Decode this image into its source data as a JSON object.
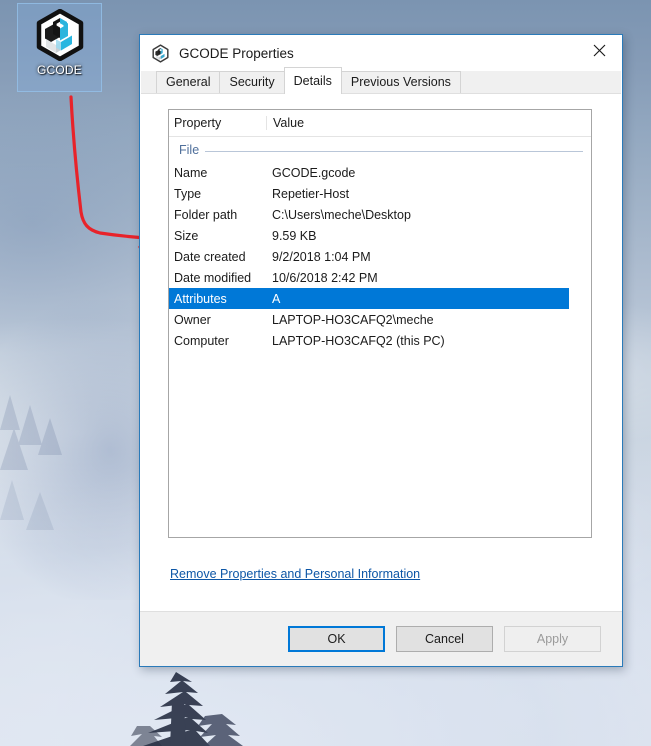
{
  "desktop": {
    "icon": {
      "name": "GCODE",
      "icon_glyph": "repetier-host-hexagon-icon",
      "selected": true
    },
    "annotation": {
      "type": "hand-drawn-arrow",
      "color": "#e8232a",
      "points_to": "Folder path"
    },
    "wallpaper": {
      "description": "misty forest mountain",
      "sky_color": "#7b94b1",
      "mist_color": "#eef1f6"
    }
  },
  "dialog": {
    "title": "GCODE Properties",
    "title_icon": "repetier-host-hexagon-icon",
    "close_label": "✕",
    "close_icon": "close-icon",
    "tabs": [
      {
        "label": "General",
        "active": false
      },
      {
        "label": "Security",
        "active": false
      },
      {
        "label": "Details",
        "active": true
      },
      {
        "label": "Previous Versions",
        "active": false
      }
    ],
    "table": {
      "headers": {
        "property": "Property",
        "value": "Value"
      },
      "groups": [
        {
          "name": "File",
          "rows": [
            {
              "property": "Name",
              "value": "GCODE.gcode",
              "selected": false
            },
            {
              "property": "Type",
              "value": "Repetier-Host",
              "selected": false
            },
            {
              "property": "Folder path",
              "value": "C:\\Users\\meche\\Desktop",
              "selected": false
            },
            {
              "property": "Size",
              "value": "9.59 KB",
              "selected": false
            },
            {
              "property": "Date created",
              "value": "9/2/2018 1:04 PM",
              "selected": false
            },
            {
              "property": "Date modified",
              "value": "10/6/2018 2:42 PM",
              "selected": false
            },
            {
              "property": "Attributes",
              "value": "A",
              "selected": true
            },
            {
              "property": "Owner",
              "value": "LAPTOP-HO3CAFQ2\\meche",
              "selected": false
            },
            {
              "property": "Computer",
              "value": "LAPTOP-HO3CAFQ2 (this PC)",
              "selected": false
            }
          ]
        }
      ]
    },
    "remove_link": "Remove Properties and Personal Information",
    "buttons": {
      "ok": "OK",
      "cancel": "Cancel",
      "apply": "Apply"
    },
    "colors": {
      "selection": "#0078d7",
      "link": "#0d56a6",
      "group_header": "#4f6f9b",
      "border": "#2a7ab9"
    }
  }
}
